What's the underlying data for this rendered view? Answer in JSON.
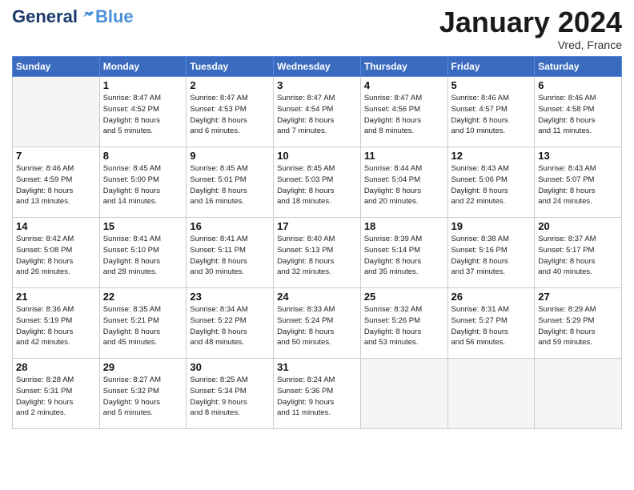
{
  "header": {
    "logo_general": "General",
    "logo_blue": "Blue",
    "month_title": "January 2024",
    "location": "Vred, France"
  },
  "days_of_week": [
    "Sunday",
    "Monday",
    "Tuesday",
    "Wednesday",
    "Thursday",
    "Friday",
    "Saturday"
  ],
  "weeks": [
    [
      {
        "day": "",
        "info": ""
      },
      {
        "day": "1",
        "info": "Sunrise: 8:47 AM\nSunset: 4:52 PM\nDaylight: 8 hours\nand 5 minutes."
      },
      {
        "day": "2",
        "info": "Sunrise: 8:47 AM\nSunset: 4:53 PM\nDaylight: 8 hours\nand 6 minutes."
      },
      {
        "day": "3",
        "info": "Sunrise: 8:47 AM\nSunset: 4:54 PM\nDaylight: 8 hours\nand 7 minutes."
      },
      {
        "day": "4",
        "info": "Sunrise: 8:47 AM\nSunset: 4:56 PM\nDaylight: 8 hours\nand 8 minutes."
      },
      {
        "day": "5",
        "info": "Sunrise: 8:46 AM\nSunset: 4:57 PM\nDaylight: 8 hours\nand 10 minutes."
      },
      {
        "day": "6",
        "info": "Sunrise: 8:46 AM\nSunset: 4:58 PM\nDaylight: 8 hours\nand 11 minutes."
      }
    ],
    [
      {
        "day": "7",
        "info": "Sunrise: 8:46 AM\nSunset: 4:59 PM\nDaylight: 8 hours\nand 13 minutes."
      },
      {
        "day": "8",
        "info": "Sunrise: 8:45 AM\nSunset: 5:00 PM\nDaylight: 8 hours\nand 14 minutes."
      },
      {
        "day": "9",
        "info": "Sunrise: 8:45 AM\nSunset: 5:01 PM\nDaylight: 8 hours\nand 16 minutes."
      },
      {
        "day": "10",
        "info": "Sunrise: 8:45 AM\nSunset: 5:03 PM\nDaylight: 8 hours\nand 18 minutes."
      },
      {
        "day": "11",
        "info": "Sunrise: 8:44 AM\nSunset: 5:04 PM\nDaylight: 8 hours\nand 20 minutes."
      },
      {
        "day": "12",
        "info": "Sunrise: 8:43 AM\nSunset: 5:06 PM\nDaylight: 8 hours\nand 22 minutes."
      },
      {
        "day": "13",
        "info": "Sunrise: 8:43 AM\nSunset: 5:07 PM\nDaylight: 8 hours\nand 24 minutes."
      }
    ],
    [
      {
        "day": "14",
        "info": "Sunrise: 8:42 AM\nSunset: 5:08 PM\nDaylight: 8 hours\nand 26 minutes."
      },
      {
        "day": "15",
        "info": "Sunrise: 8:41 AM\nSunset: 5:10 PM\nDaylight: 8 hours\nand 28 minutes."
      },
      {
        "day": "16",
        "info": "Sunrise: 8:41 AM\nSunset: 5:11 PM\nDaylight: 8 hours\nand 30 minutes."
      },
      {
        "day": "17",
        "info": "Sunrise: 8:40 AM\nSunset: 5:13 PM\nDaylight: 8 hours\nand 32 minutes."
      },
      {
        "day": "18",
        "info": "Sunrise: 8:39 AM\nSunset: 5:14 PM\nDaylight: 8 hours\nand 35 minutes."
      },
      {
        "day": "19",
        "info": "Sunrise: 8:38 AM\nSunset: 5:16 PM\nDaylight: 8 hours\nand 37 minutes."
      },
      {
        "day": "20",
        "info": "Sunrise: 8:37 AM\nSunset: 5:17 PM\nDaylight: 8 hours\nand 40 minutes."
      }
    ],
    [
      {
        "day": "21",
        "info": "Sunrise: 8:36 AM\nSunset: 5:19 PM\nDaylight: 8 hours\nand 42 minutes."
      },
      {
        "day": "22",
        "info": "Sunrise: 8:35 AM\nSunset: 5:21 PM\nDaylight: 8 hours\nand 45 minutes."
      },
      {
        "day": "23",
        "info": "Sunrise: 8:34 AM\nSunset: 5:22 PM\nDaylight: 8 hours\nand 48 minutes."
      },
      {
        "day": "24",
        "info": "Sunrise: 8:33 AM\nSunset: 5:24 PM\nDaylight: 8 hours\nand 50 minutes."
      },
      {
        "day": "25",
        "info": "Sunrise: 8:32 AM\nSunset: 5:26 PM\nDaylight: 8 hours\nand 53 minutes."
      },
      {
        "day": "26",
        "info": "Sunrise: 8:31 AM\nSunset: 5:27 PM\nDaylight: 8 hours\nand 56 minutes."
      },
      {
        "day": "27",
        "info": "Sunrise: 8:29 AM\nSunset: 5:29 PM\nDaylight: 8 hours\nand 59 minutes."
      }
    ],
    [
      {
        "day": "28",
        "info": "Sunrise: 8:28 AM\nSunset: 5:31 PM\nDaylight: 9 hours\nand 2 minutes."
      },
      {
        "day": "29",
        "info": "Sunrise: 8:27 AM\nSunset: 5:32 PM\nDaylight: 9 hours\nand 5 minutes."
      },
      {
        "day": "30",
        "info": "Sunrise: 8:25 AM\nSunset: 5:34 PM\nDaylight: 9 hours\nand 8 minutes."
      },
      {
        "day": "31",
        "info": "Sunrise: 8:24 AM\nSunset: 5:36 PM\nDaylight: 9 hours\nand 11 minutes."
      },
      {
        "day": "",
        "info": ""
      },
      {
        "day": "",
        "info": ""
      },
      {
        "day": "",
        "info": ""
      }
    ]
  ]
}
